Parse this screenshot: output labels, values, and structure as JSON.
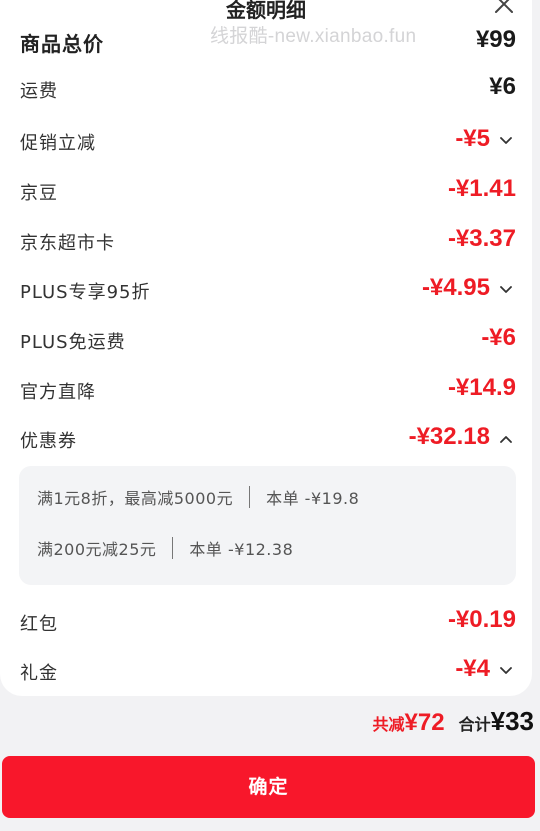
{
  "header": {
    "title": "金额明细",
    "watermark": "线报酷-new.xianbao.fun",
    "close_icon": "close-icon"
  },
  "rows": [
    {
      "label": "商品总价",
      "amount": "¥99",
      "discount": false,
      "arrow": "none"
    },
    {
      "label": "运费",
      "amount": "¥6",
      "discount": false,
      "arrow": "none"
    },
    {
      "label": "促销立减",
      "amount": "-¥5",
      "discount": true,
      "arrow": "chevron-down-icon"
    },
    {
      "label": "京豆",
      "amount": "-¥1.41",
      "discount": true,
      "arrow": "none"
    },
    {
      "label": "京东超市卡",
      "amount": "-¥3.37",
      "discount": true,
      "arrow": "none"
    },
    {
      "label": "PLUS专享95折",
      "amount": "-¥4.95",
      "discount": true,
      "arrow": "chevron-down-icon"
    },
    {
      "label": "PLUS免运费",
      "amount": "-¥6",
      "discount": true,
      "arrow": "none"
    },
    {
      "label": "官方直降",
      "amount": "-¥14.9",
      "discount": true,
      "arrow": "none"
    },
    {
      "label": "优惠券",
      "amount": "-¥32.18",
      "discount": true,
      "arrow": "chevron-up-icon"
    },
    {
      "label": "红包",
      "amount": "-¥0.19",
      "discount": true,
      "arrow": "none"
    },
    {
      "label": "礼金",
      "amount": "-¥4",
      "discount": true,
      "arrow": "chevron-down-icon"
    }
  ],
  "coupons": [
    {
      "condition": "满1元8折，最高减5000元",
      "saving": "本单 -¥19.8"
    },
    {
      "condition": "满200元减25元",
      "saving": "本单 -¥12.38"
    }
  ],
  "footer": {
    "reduce_label": "共减",
    "reduce_value": "¥72",
    "sum_label": "合计",
    "sum_value": "¥33",
    "confirm_label": "确定"
  },
  "colors": {
    "accent": "#ee1c25",
    "button": "#f8172b",
    "coupon_bg": "#f3f4f6"
  }
}
